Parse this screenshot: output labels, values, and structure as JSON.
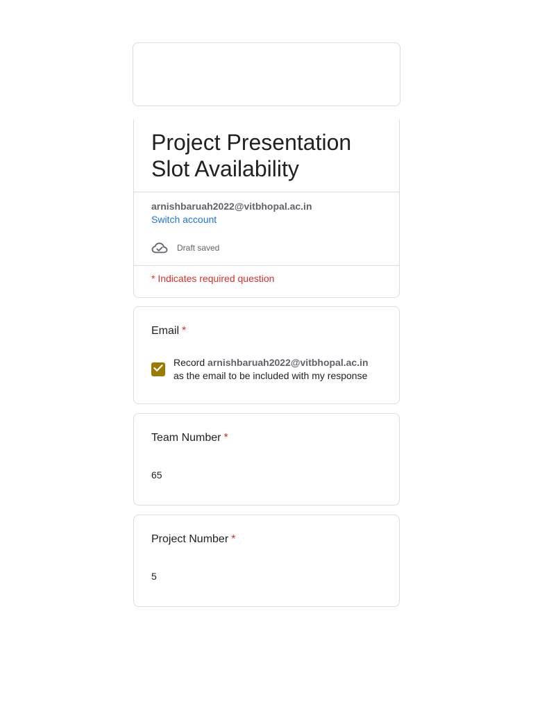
{
  "form": {
    "title": "Project Presentation Slot Availability",
    "account_email": "arnishbaruah2022@vitbhopal.ac.in",
    "switch_account": "Switch account",
    "draft_status": "Draft saved",
    "required_note": "* Indicates required question"
  },
  "questions": {
    "email": {
      "label": "Email",
      "required_mark": "*",
      "record_prefix": "Record",
      "record_email": "arnishbaruah2022@vitbhopal.ac.in",
      "record_suffix": "as the email to be included with my response",
      "checked": true
    },
    "team_number": {
      "label": "Team Number",
      "required_mark": "*",
      "value": "65"
    },
    "project_number": {
      "label": "Project Number",
      "required_mark": "*",
      "value": "5"
    }
  },
  "icons": {
    "draft": "cloud-check-icon",
    "checkbox": "checkmark-icon"
  },
  "colors": {
    "required": "#d93025",
    "link": "#1a73e8",
    "checkbox": "#9c7a00"
  }
}
